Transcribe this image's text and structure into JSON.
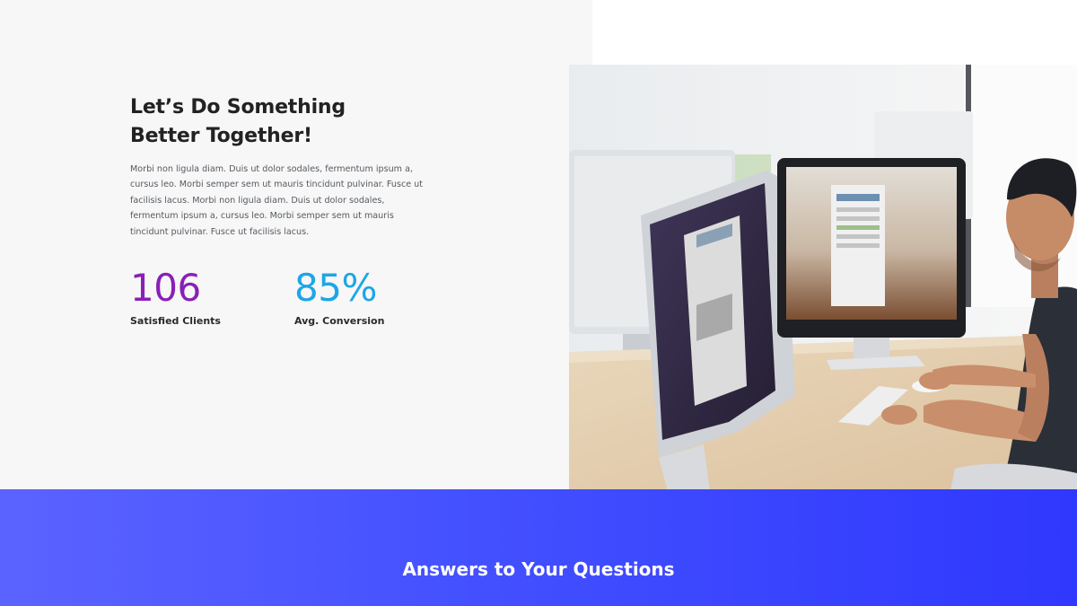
{
  "hero": {
    "headline": "Let’s Do Something Better Together!",
    "body": "Morbi non ligula diam. Duis ut dolor sodales, fermentum ipsum a, cursus leo. Morbi semper sem ut mauris tincidunt pulvinar. Fusce ut facilisis lacus. Morbi non ligula diam. Duis ut dolor sodales, fermentum ipsum a, cursus leo. Morbi semper sem ut mauris tincidunt pulvinar. Fusce ut facilisis lacus."
  },
  "stats": [
    {
      "value": "106",
      "label": "Satisfied Clients",
      "color": "#8a1fb8"
    },
    {
      "value": "85%",
      "label": "Avg. Conversion",
      "color": "#1ea6e6"
    }
  ],
  "photo": {
    "icon": "office-workspace-photo"
  },
  "band": {
    "title": "Answers to Your Questions",
    "gradient_start": "#5b63ff",
    "gradient_end": "#2f38fd"
  }
}
